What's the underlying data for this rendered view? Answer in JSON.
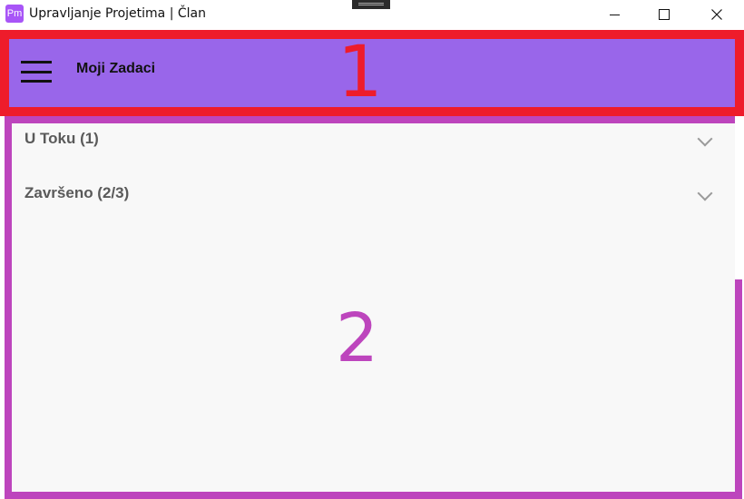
{
  "window": {
    "app_icon_text": "Pm",
    "title": "Upravljanje Projetima | Član"
  },
  "appbar": {
    "title": "Moji Zadaci",
    "menu_icon": "hamburger-icon",
    "background": "#9966ea"
  },
  "sections": [
    {
      "label": "U Toku (1)",
      "icon": "chevron-down-icon"
    },
    {
      "label": "Završeno (2/3)",
      "icon": "chevron-down-icon"
    }
  ],
  "annotations": {
    "region_1": "1",
    "region_2": "2",
    "region_1_color": "#ee1c2b",
    "region_2_color": "#bd45bd"
  }
}
